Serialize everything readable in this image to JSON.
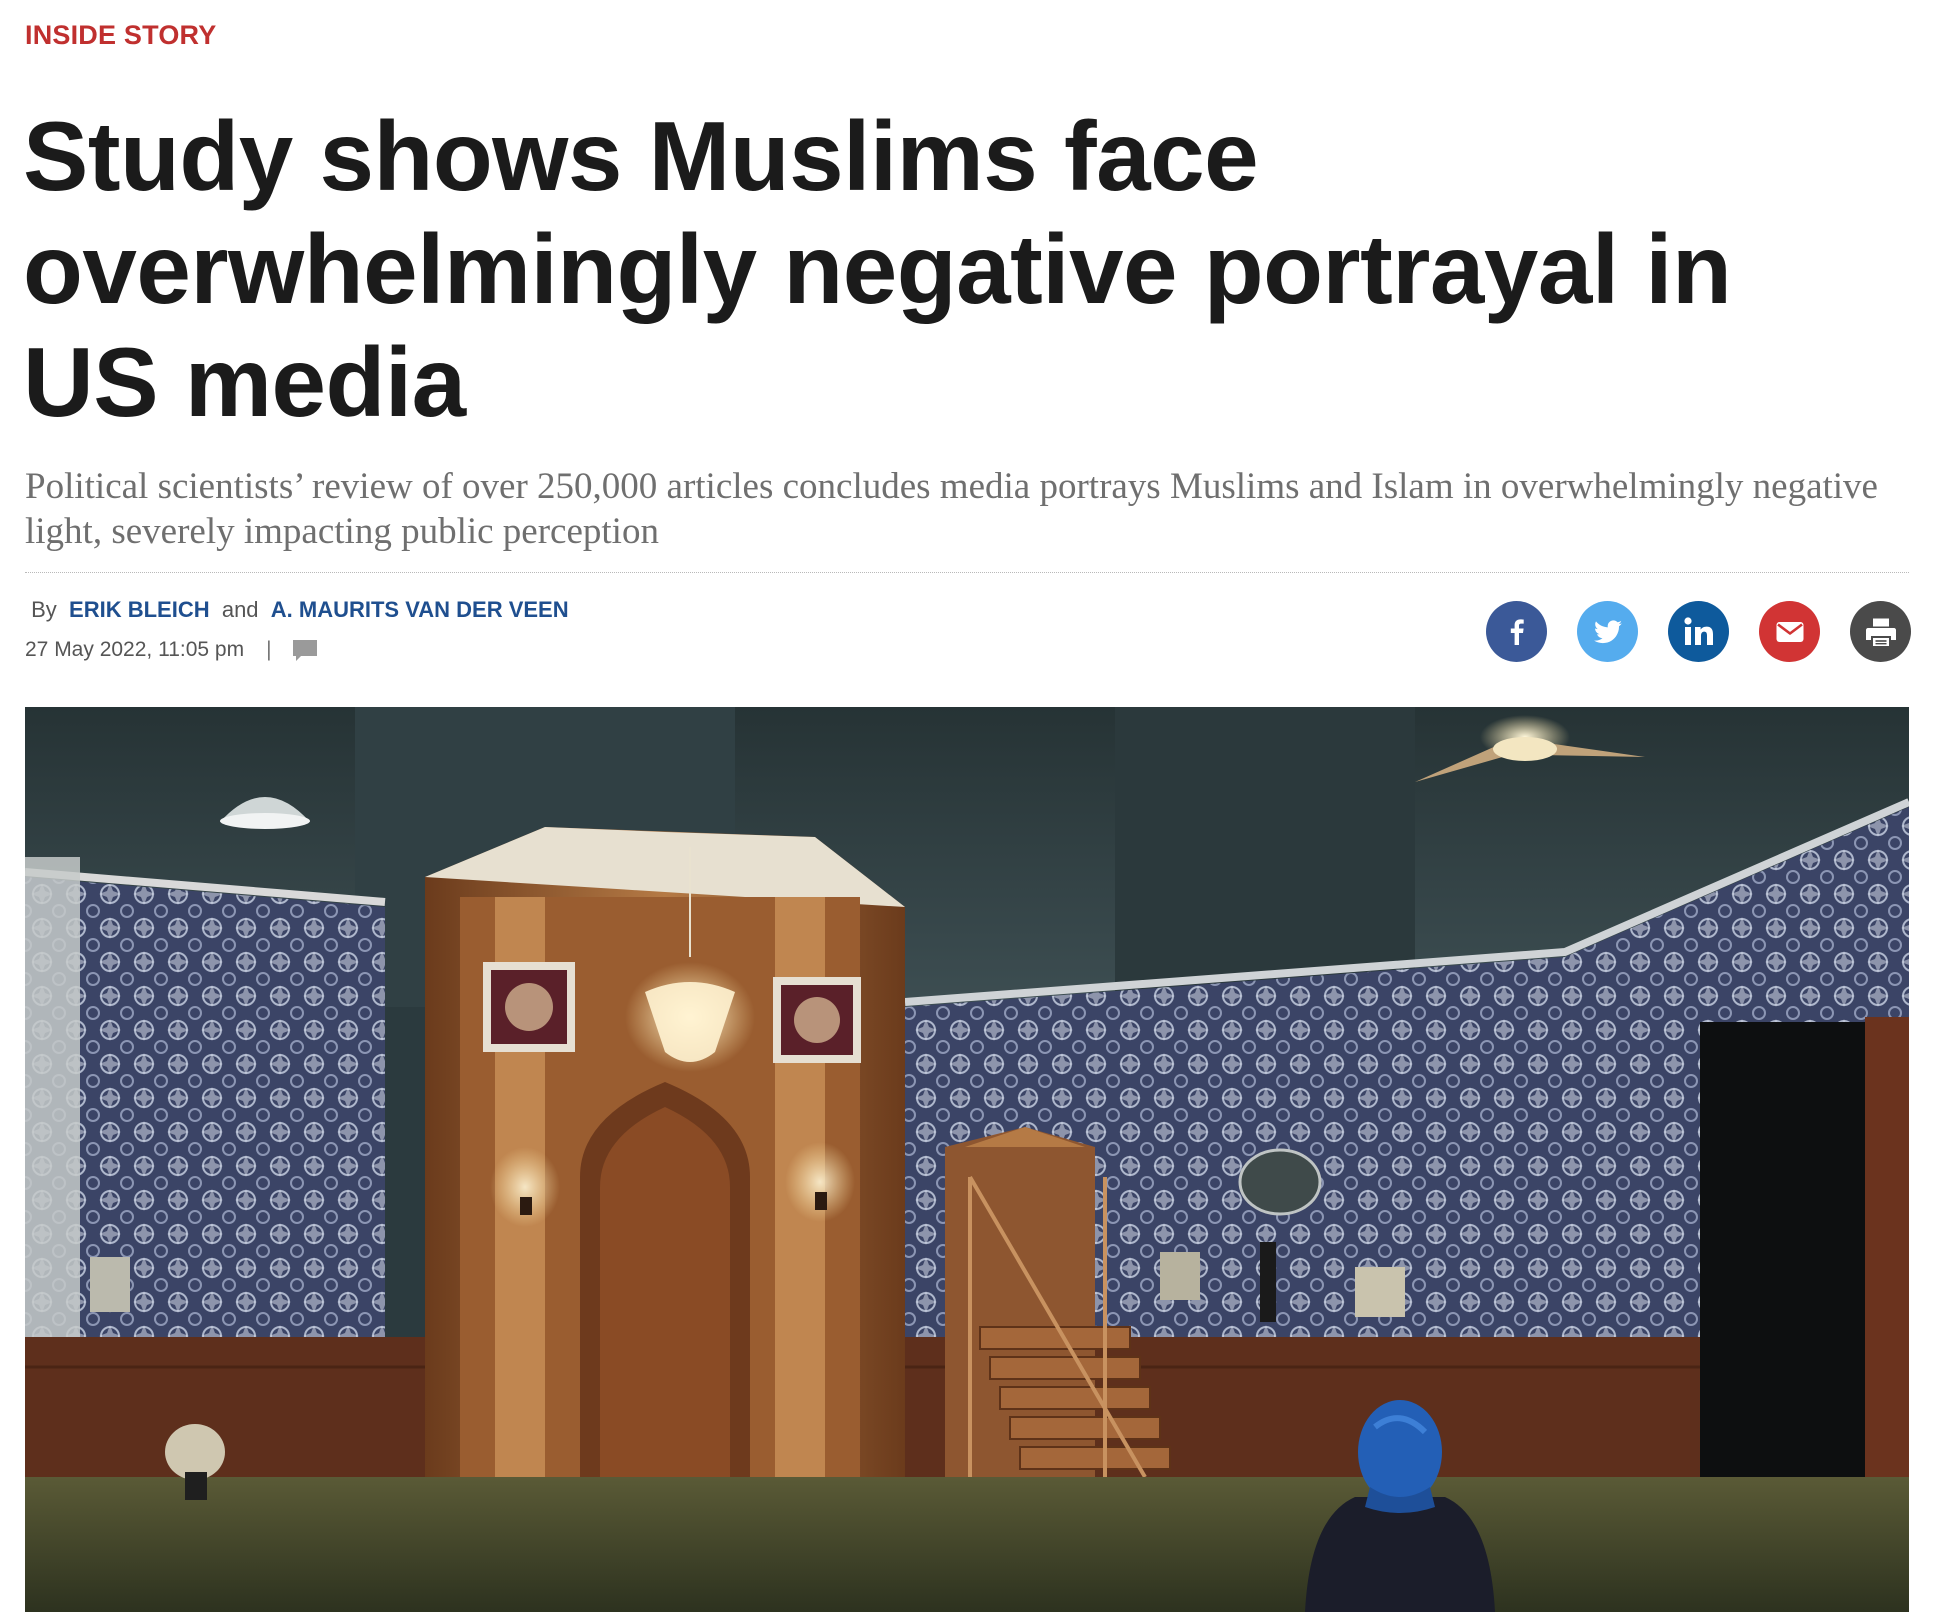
{
  "article": {
    "kicker": "INSIDE STORY",
    "headline": "Study shows Muslims face overwhelmingly negative portrayal in US media",
    "standfirst": "Political scientists’ review of over 250,000 articles concludes media portrays Muslims and Islam in overwhelmingly negative light, severely impacting public perception",
    "byline": {
      "by": "By",
      "author1": "ERIK BLEICH",
      "and": "and",
      "author2": "A. MAURITS VAN DER VEEN"
    },
    "date": "27 May 2022, 11:05 pm",
    "separator": "|"
  },
  "share": {
    "buttons": [
      {
        "name": "facebook",
        "icon": "facebook-icon",
        "color": "#3b5998"
      },
      {
        "name": "twitter",
        "icon": "twitter-icon",
        "color": "#55acee"
      },
      {
        "name": "linkedin",
        "icon": "linkedin-icon",
        "color": "#0e5a9c"
      },
      {
        "name": "email",
        "icon": "email-icon",
        "color": "#d13434"
      },
      {
        "name": "print",
        "icon": "print-icon",
        "color": "#4a4a4a"
      }
    ]
  },
  "hero_image": {
    "subject": "mosque interior with mihrab, minbar and woman in blue headscarf"
  },
  "colors": {
    "kicker": "#c0302f",
    "author_link": "#1f4f8f",
    "headline": "#1b1b1b",
    "standfirst": "#6f6f6f"
  }
}
